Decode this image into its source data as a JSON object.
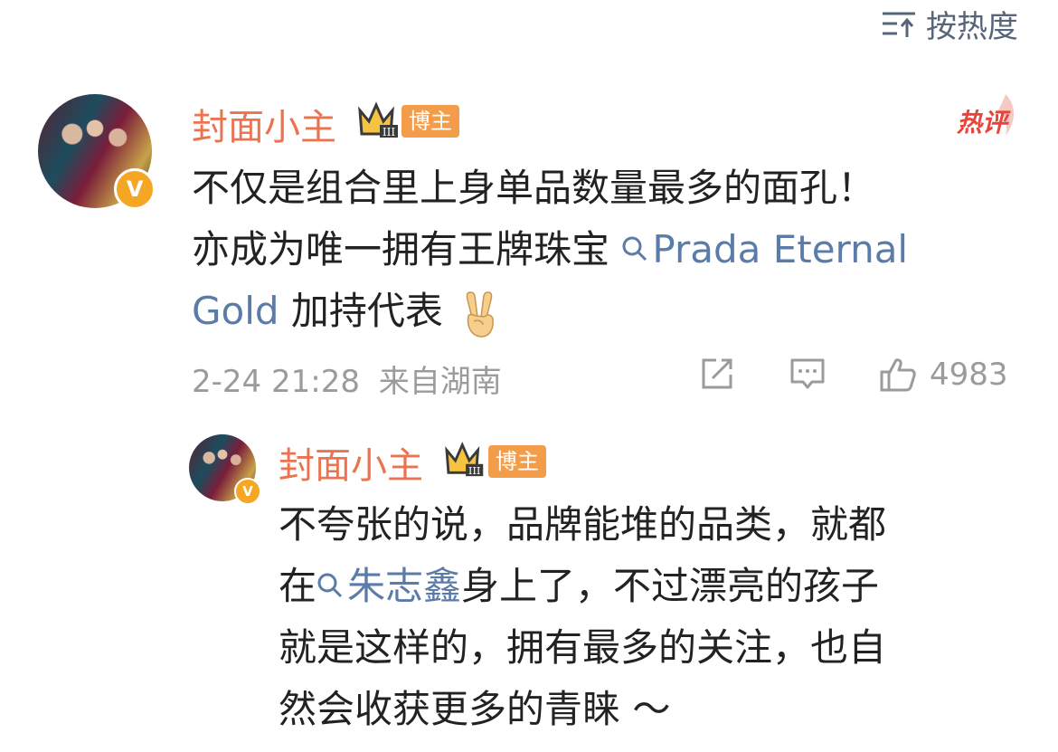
{
  "sort": {
    "label": "按热度"
  },
  "comment": {
    "author": "封面小主",
    "badge_label": "博主",
    "hot_label": "热评",
    "lines": [
      {
        "parts": [
          {
            "text": "不仅是组合里上身单品数量最多的面孔！"
          }
        ]
      },
      {
        "parts": [
          {
            "text": "亦成为唯一拥有王牌珠宝 "
          },
          {
            "link": "Prada Eternal"
          }
        ]
      },
      {
        "parts": [
          {
            "link_cont": "Gold"
          },
          {
            "text": " 加持代表"
          }
        ],
        "emoji": "victory-hand"
      }
    ],
    "timestamp": "2-24 21:28",
    "location": "来自湖南",
    "like_count": "4983"
  },
  "reply": {
    "author": "封面小主",
    "badge_label": "博主",
    "line1": "不夸张的说，品牌能堆的品类，就都",
    "line2_pre": "在",
    "line2_link": "朱志鑫",
    "line2_post": "身上了，不过漂亮的孩子",
    "line3": "就是这样的，拥有最多的关注，也自",
    "line4": "然会收获更多的青睐 ～"
  },
  "colors": {
    "author": "#eb7350",
    "link": "#5b7ba9",
    "meta": "#9b9b9b",
    "hot": "#e8443a",
    "badge": "#f39c4a"
  }
}
